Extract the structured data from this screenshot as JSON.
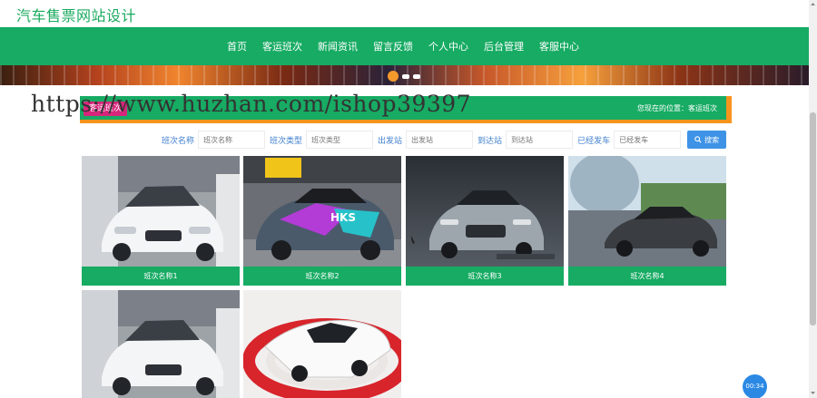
{
  "site": {
    "title": "汽车售票网站设计"
  },
  "nav": {
    "items": [
      {
        "label": "首页"
      },
      {
        "label": "客运班次"
      },
      {
        "label": "新闻资讯"
      },
      {
        "label": "留言反馈"
      },
      {
        "label": "个人中心"
      },
      {
        "label": "后台管理"
      },
      {
        "label": "客服中心"
      }
    ]
  },
  "breadcrumb": {
    "tag": "客运班次",
    "location": "您现在的位置：客运班次"
  },
  "watermark": "https://www.huzhan.com/ishop39397",
  "search": {
    "fields": [
      {
        "label": "班次名称",
        "placeholder": "班次名称"
      },
      {
        "label": "班次类型",
        "placeholder": "班次类型"
      },
      {
        "label": "出发站",
        "placeholder": "出发站"
      },
      {
        "label": "到达站",
        "placeholder": "到达站"
      },
      {
        "label": "已经发车",
        "placeholder": "已经发车"
      }
    ],
    "button_label": "搜索"
  },
  "cards": [
    {
      "caption": "班次名称1"
    },
    {
      "caption": "班次名称2"
    },
    {
      "caption": "班次名称3"
    },
    {
      "caption": "班次名称4"
    },
    {
      "caption": ""
    },
    {
      "caption": ""
    }
  ],
  "timer": "00:34",
  "colors": {
    "brand_green": "#17ab63",
    "accent_orange": "#f7941d",
    "link_blue": "#3f7fce",
    "button_blue": "#3e93e6",
    "tag_pink": "#d6267b"
  }
}
